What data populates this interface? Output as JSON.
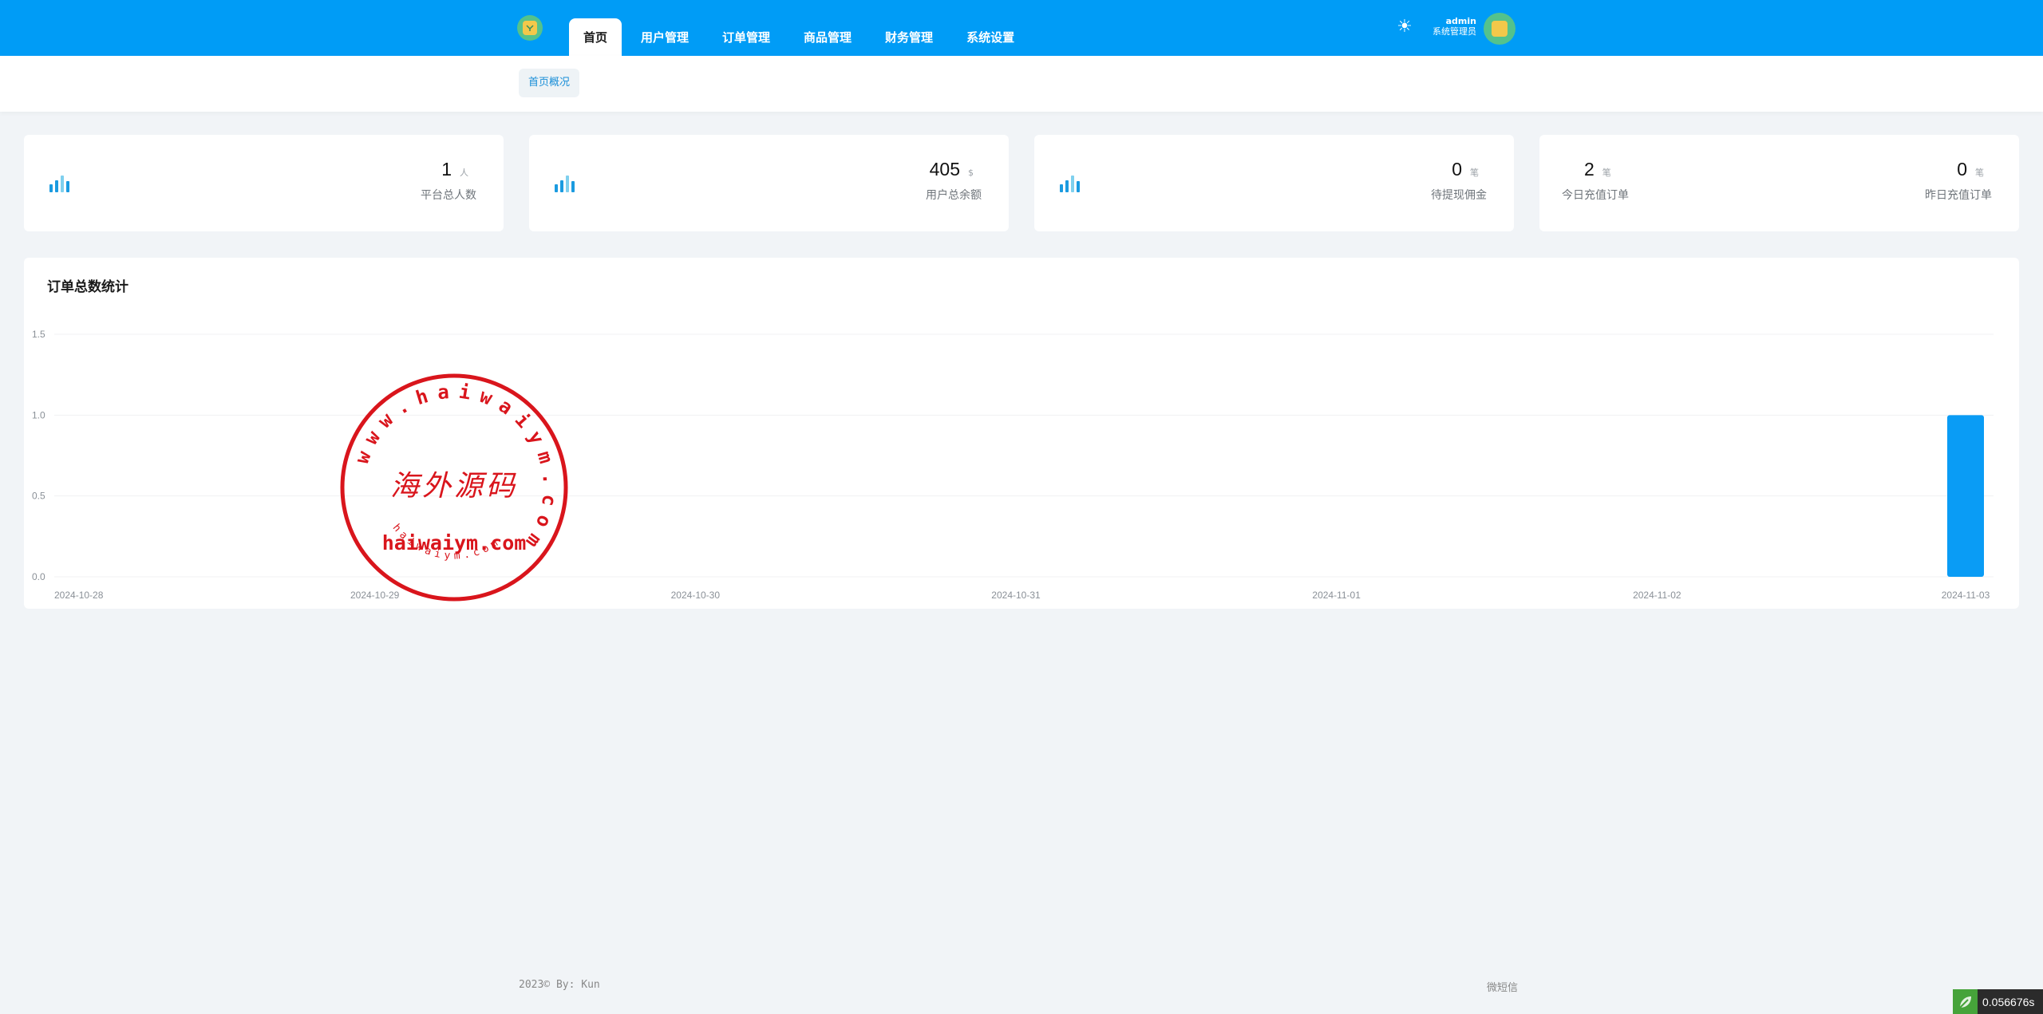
{
  "nav": {
    "items": [
      {
        "label": "首页",
        "active": true
      },
      {
        "label": "用户管理",
        "active": false
      },
      {
        "label": "订单管理",
        "active": false
      },
      {
        "label": "商品管理",
        "active": false
      },
      {
        "label": "财务管理",
        "active": false
      },
      {
        "label": "系统设置",
        "active": false
      }
    ]
  },
  "user": {
    "name": "admin",
    "role": "系统管理员"
  },
  "subtabs": [
    {
      "label": "首页概况"
    }
  ],
  "stats": [
    {
      "value": "1",
      "unit": "人",
      "label": "平台总人数"
    },
    {
      "value": "405",
      "unit": "$",
      "label": "用户总余额"
    },
    {
      "value": "0",
      "unit": "笔",
      "label": "待提现佣金"
    },
    {
      "value": "2",
      "unit": "笔",
      "label": "今日充值订单"
    },
    {
      "value": "0",
      "unit": "笔",
      "label": "昨日充值订单"
    }
  ],
  "chart": {
    "title": "订单总数统计"
  },
  "chart_data": {
    "type": "bar",
    "categories": [
      "2024-10-28",
      "2024-10-29",
      "2024-10-30",
      "2024-10-31",
      "2024-11-01",
      "2024-11-02",
      "2024-11-03"
    ],
    "values": [
      0,
      0,
      0,
      0,
      0,
      0,
      1
    ],
    "yticks": [
      "0.0",
      "0.5",
      "1.0",
      "1.5"
    ],
    "ylim": [
      0,
      1.5
    ],
    "grid": true,
    "color": "#0a9cf5"
  },
  "watermark": {
    "ring_text": "www.haiwaiym.com",
    "center_text": "海外源码",
    "domain_text": "haiwaiym.com",
    "bottom_text": "haiwaiym.com",
    "color": "#d9151c"
  },
  "footer": {
    "copyright": "2023© By: Kun",
    "right": "微短信"
  },
  "timer": {
    "value": "0.056676s"
  },
  "colors": {
    "primary": "#009cf6",
    "bar": "#0a9cf5",
    "bg": "#f1f4f7"
  }
}
